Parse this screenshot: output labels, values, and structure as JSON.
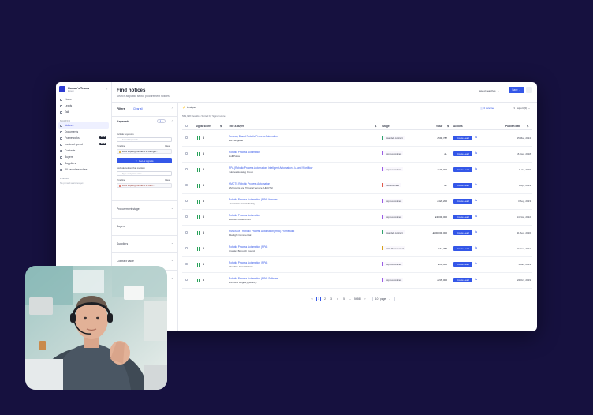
{
  "sidebar": {
    "team_name": "Human's Teams",
    "team_subtitle": "Expert",
    "top_items": [
      {
        "label": "Home"
      },
      {
        "label": "Leads"
      },
      {
        "label": "Talk"
      }
    ],
    "search_section_label": "SEARCH",
    "search_items": [
      {
        "label": "Notices",
        "active": true
      },
      {
        "label": "Documents"
      },
      {
        "label": "Frameworks",
        "badge": "BETA"
      },
      {
        "label": "Invoiced spend",
        "badge": "BETA"
      },
      {
        "label": "Contacts"
      },
      {
        "label": "Buyers"
      },
      {
        "label": "Suppliers"
      },
      {
        "label": "All saved searches"
      }
    ],
    "pinned_section_label": "PINNED",
    "pinned_empty": "No pinned searches yet"
  },
  "header": {
    "title": "Find notices",
    "subtitle": "Search all public sector procurement notices",
    "saved_searches_label": "Saved searches",
    "save_label": "Save"
  },
  "filters": {
    "title": "Filters",
    "clear_all": "Clear all",
    "keywords_label": "Keywords",
    "keywords_toggle": "1 ●",
    "include_label": "Include keywords",
    "include_placeholder": "Search keywords",
    "include_chip": "2026 expiring contracts in Georgia...",
    "ai_button": "Get AI signals",
    "exclude_label": "Exclude notices that mention",
    "exclude_placeholder": "Type and press enter",
    "timeline_label": "Timeline",
    "timeline_clear": "Clear",
    "timeline_chip": "2026 expiring contracts in Geor...",
    "sections": [
      "Procurement stage",
      "Buyers",
      "Suppliers",
      "Contract value",
      "Contract dates"
    ]
  },
  "results": {
    "analyse_label": "Analyse",
    "count_text": "569,798 Results  •  Sorted by Signal score",
    "selected_label": "0 selected",
    "export_label": "Export (0)",
    "columns": {
      "signal": "Signal score",
      "title": "Title & buyer",
      "stage": "Stage",
      "value": "Value",
      "actions": "Actions",
      "publish": "Publish date"
    },
    "create_lead_label": "Create Lead",
    "rows": [
      {
        "score": "3",
        "title": "Tenancy Based Robotic Process Automation",
        "buyer": "NHS England",
        "stage": "Awarded contract",
        "stage_color": "#2fa36b",
        "value": "£590,787",
        "date": "15 Mar, 2024"
      },
      {
        "score": "3",
        "title": "Robotic Process Automation",
        "buyer": "Hull Police",
        "stage": "Expired contract",
        "stage_color": "#9b5de5",
        "value": "£ -",
        "date": "16 Dec, 2018"
      },
      {
        "score": "3",
        "title": "RPA (Robotic Process Automation) Intelligent Automation - IA and Workflow",
        "buyer": "Futures Housing Group",
        "stage": "Expired contract",
        "stage_color": "#9b5de5",
        "value": "£100,000",
        "date": "5 Jul, 2020"
      },
      {
        "score": "3",
        "title": "HMCTS Robotic Process Automation",
        "buyer": "HM Courts and Tribunal Service (HMCTS)",
        "stage": "Closed tender",
        "stage_color": "#e05a4a",
        "value": "£ -",
        "date": "8 Apr, 2019"
      },
      {
        "score": "3",
        "title": "Robotic Process Automation (RPA) licences",
        "buyer": "Lancashire Constabulary",
        "stage": "Expired contract",
        "stage_color": "#9b5de5",
        "value": "£420,200",
        "date": "3 Aug, 2023"
      },
      {
        "score": "3",
        "title": "Robotic Process Automation",
        "buyer": "Scottish Government",
        "stage": "Expired contract",
        "stage_color": "#9b5de5",
        "value": "£3,000,000",
        "date": "14 Nov, 2022"
      },
      {
        "score": "3",
        "title": "RM3/ALM - Robotic Process Automation (RPA) Framework",
        "buyer": "Bluelight Commercial",
        "stage": "Awarded contract",
        "stage_color": "#2fa36b",
        "value": "£100,000,000",
        "date": "31 Aug, 2020"
      },
      {
        "score": "3",
        "title": "Robotic Process Automation (RPA)",
        "buyer": "Crawley Borough Council",
        "stage": "Stale Procurement",
        "stage_color": "#d8a21c",
        "value": "£41,750",
        "date": "22 Dec, 2021"
      },
      {
        "score": "3",
        "title": "Robotic Process Automation (RPA)",
        "buyer": "Cheshire Constabulary",
        "stage": "Expired contract",
        "stage_color": "#9b5de5",
        "value": "£50,000",
        "date": "1 Jan, 2019"
      },
      {
        "score": "3",
        "title": "Robotic Process Automation (RPA) Software",
        "buyer": "HM Land Registry (HMLR)",
        "stage": "Expired contract",
        "stage_color": "#9b5de5",
        "value": "£235,000",
        "date": "22 Oct, 2019"
      }
    ],
    "pagination": {
      "pages": [
        "1",
        "2",
        "3",
        "4",
        "5",
        "...",
        "56980"
      ],
      "current": "1",
      "per_page": "10 / page"
    }
  },
  "icons": {
    "chevron_down": "⌄",
    "link": "⇋"
  },
  "colors": {
    "accent": "#3457e8",
    "background": "#16113f",
    "signal": "#29a25a"
  }
}
